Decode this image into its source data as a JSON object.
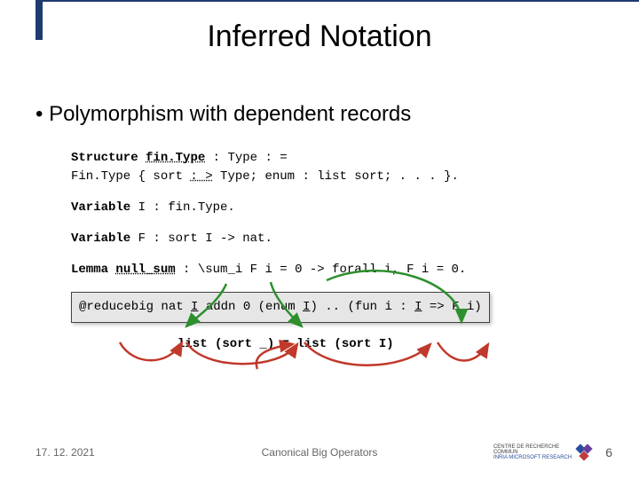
{
  "title": "Inferred Notation",
  "bullet": "Polymorphism with dependent records",
  "code": {
    "struct_kw": "Structure",
    "struct_name": "fin.Type",
    "struct_rest1": " : Type : =",
    "struct_line2_a": " Fin.Type { sort ",
    "struct_line2_b": ": >",
    "struct_line2_c": " Type; enum : list sort; . . . }.",
    "var_kw1": "Variable",
    "var_I": " I : fin.Type.",
    "var_kw2": "Variable",
    "var_F": " F : sort I -> nat.",
    "lemma_kw": "Lemma",
    "lemma_name": "null_sum",
    "lemma_rest": " : \\sum_i F i = 0 -> forall i, F i = 0.",
    "grey_a": "@reducebig nat ",
    "grey_I": "I",
    "grey_b": " addn 0 (enum ",
    "grey_I2": "I",
    "grey_c": ") .. (fun i : ",
    "grey_I3": "I",
    "grey_d": " => F i)",
    "list_eq": "list (sort _) = list (sort I)"
  },
  "footer": {
    "date": "17. 12. 2021",
    "center": "Canonical Big Operators",
    "logo_line1": "CENTRE DE RECHERCHE",
    "logo_line2": "COMMUN",
    "logo_line3": "INRIA MICROSOFT RESEARCH",
    "page": "6"
  }
}
